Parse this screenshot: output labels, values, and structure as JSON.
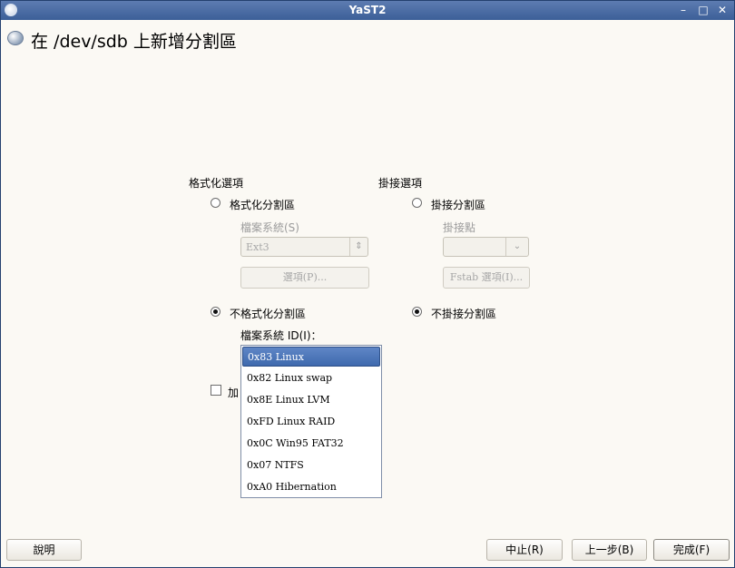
{
  "window": {
    "title": "YaST2"
  },
  "heading": "在 /dev/sdb 上新增分割區",
  "format_options": {
    "title": "格式化選項",
    "format_radio": "格式化分割區",
    "fs_label": "檔案系統(S)",
    "fs_value": "Ext3",
    "options_button": "選項(P)...",
    "noformat_radio": "不格式化分割區",
    "fsid_label": "檔案系統 ID(I)：",
    "encrypt_partial": "加"
  },
  "mount_options": {
    "title": "掛接選項",
    "mount_radio": "掛接分割區",
    "mountpoint_label": "掛接點",
    "mountpoint_value": "",
    "fstab_button": "Fstab 選項(I)...",
    "nomount_radio": "不掛接分割區"
  },
  "fsid_list": [
    "0x83 Linux",
    "0x82 Linux swap",
    "0x8E Linux LVM",
    "0xFD Linux RAID",
    "0x0C Win95 FAT32",
    "0x07 NTFS",
    "0xA0 Hibernation"
  ],
  "buttons": {
    "help": "說明",
    "abort": "中止(R)",
    "back": "上一步(B)",
    "finish": "完成(F)"
  },
  "colors": {
    "titlebar": "#4a6ca4",
    "selection": "#4b76b8",
    "background": "#fbf9f4"
  }
}
